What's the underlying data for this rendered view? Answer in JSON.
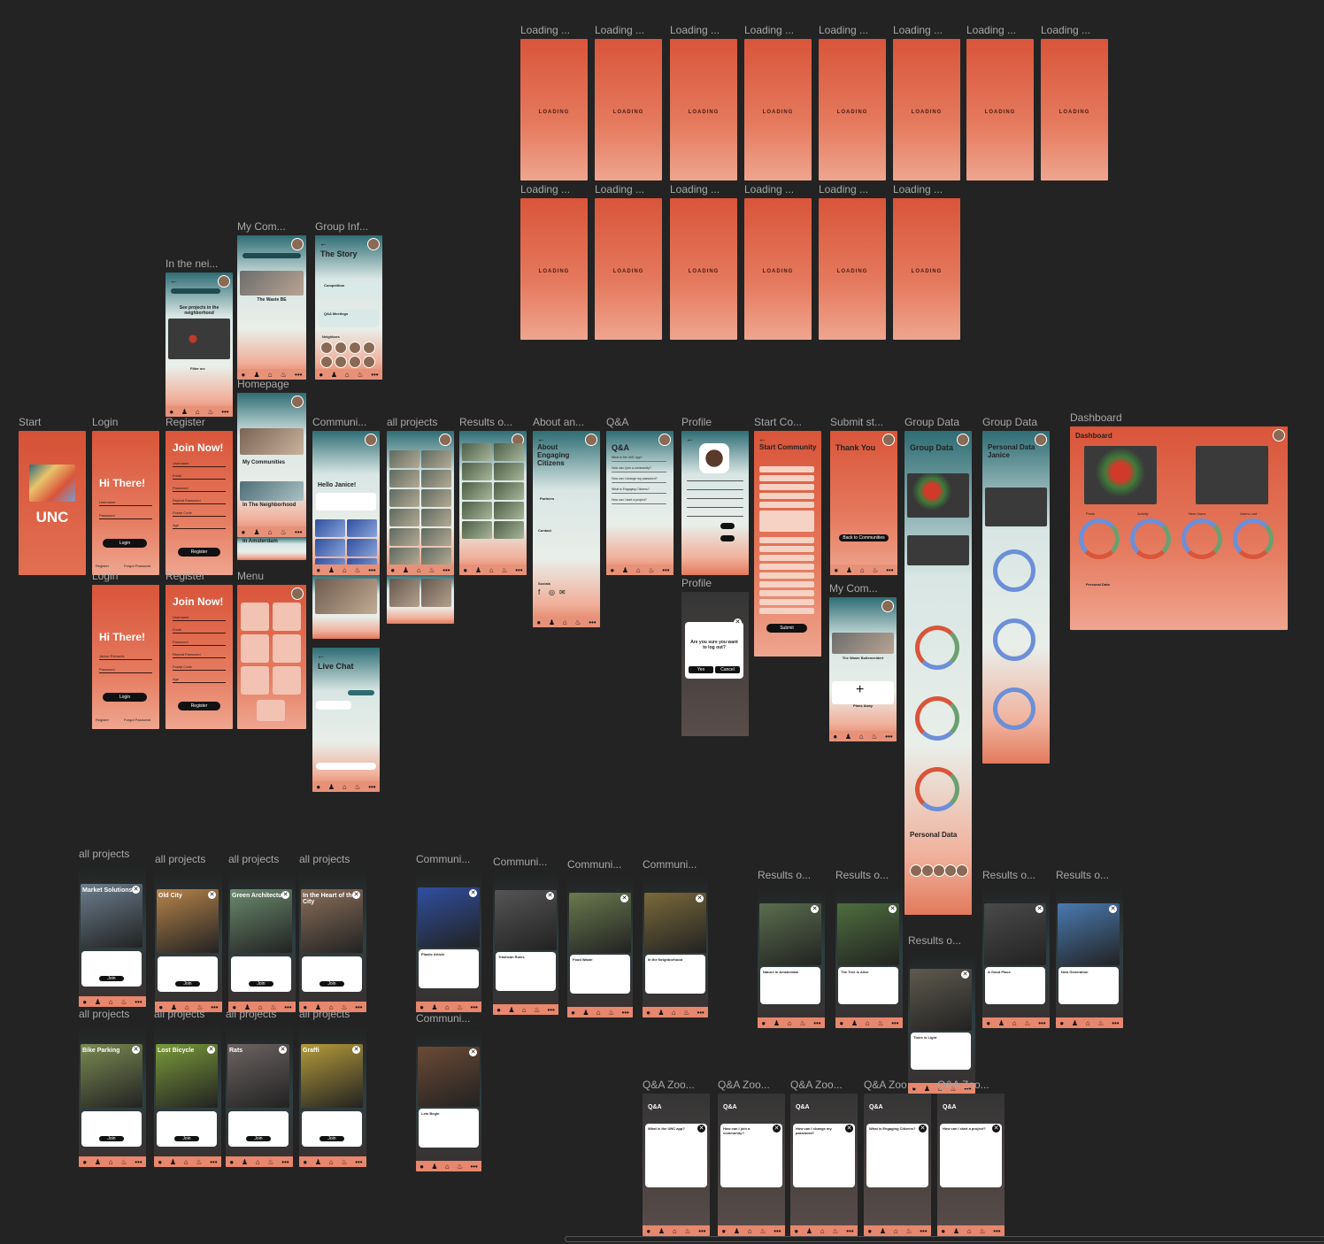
{
  "colors": {
    "canvas": "#232323",
    "brand": "#d9553a",
    "teal": "#2f6c72"
  },
  "labels": {
    "loading": "Loading ...",
    "start": "Start",
    "login": "Login",
    "register": "Register",
    "menu": "Menu",
    "in_neighborhood": "In the nei...",
    "my_communities": "My Com...",
    "group_info": "Group Inf...",
    "homepage": "Homepage",
    "communities": "Communi...",
    "all_projects": "all projects",
    "results": "Results o...",
    "about": "About an...",
    "qa": "Q&A",
    "profile": "Profile",
    "start_community": "Start Co...",
    "submit": "Submit st...",
    "group_data": "Group Data",
    "dashboard": "Dashboard",
    "qa_zoom": "Q&A Zoo..."
  },
  "loading_screen_text": "LOADING",
  "screens": {
    "start_logo": "UNC",
    "login_title": "Hi There!",
    "login_user": "Username",
    "login_pass": "Password",
    "login_btn": "Login",
    "login_link_register": "Register",
    "login_link_forgot": "Forgot Password",
    "login2_user": "Janice Richards",
    "register_title": "Join Now!",
    "register_btn": "Register",
    "register_fields": [
      "Username",
      "Email",
      "Password",
      "Repeat Password",
      "Postal Code",
      "Age"
    ],
    "group_info_title": "The Story",
    "group_info_section1": "Competition",
    "group_info_section2": "Q&A Meetings",
    "group_info_section3": "Neighbors",
    "neighborhood_title": "See projects in the neighborhood",
    "neighborhood_filter": "Filter on:",
    "my_comm_item": "The Waste BE",
    "homepage_tiles": [
      "My Communities",
      "In The Neighborhood",
      "In Amsterdam"
    ],
    "communities_greeting": "Hello Janice!",
    "live_chat": "Live Chat",
    "about_title": "About Engaging Citizens",
    "about_partners": "Partners",
    "about_contact": "Contact",
    "about_socials": "Socials",
    "qa_title": "Q&A",
    "qa_questions": [
      "What is the UNC app?",
      "How can I join a community?",
      "How can I change my password?",
      "What is Engaging Citizens?",
      "How can I start a project?"
    ],
    "start_comm_title": "Start Community",
    "submit_title": "Thank You",
    "submit_btn": "Back to Communities",
    "submit_btn2": "Submit",
    "group_data_title": "Group Data",
    "personal_data_title": "Personal Data Janice",
    "personal_data_short": "Personal Data",
    "logout_question": "Are you sure you want to log out?",
    "logout_yes": "Yes",
    "logout_cancel": "Cancel",
    "dashboard_title": "Dashboard",
    "dashboard_stats": [
      "Posts",
      "Activity",
      "New Users",
      "Users Lost"
    ],
    "dashboard_personal": "Personal Data",
    "my_comm_wide_title": "The Waste Buitenveldert",
    "plus_label": "Plans Away",
    "projects": [
      "Market Solutions",
      "Old City",
      "Green Architecture",
      "In the Heart of the City",
      "Bike Parking",
      "Lost Bicycle",
      "Rats",
      "Graffi"
    ],
    "project_btn": "Join",
    "comm_posts": [
      "Plastic Article",
      "Trashcan Rules",
      "Food Waste",
      "In the Neighborhood",
      "Lets Begin"
    ],
    "results_posts": [
      "Nature in Amsterdam",
      "The Tree is Alive",
      "There is Light",
      "A Good Place",
      "New Generation"
    ],
    "qa_zoom_questions": [
      "What is the UNC app?",
      "How can I join a community?",
      "How can I change my password?",
      "What is Engaging Citizens?",
      "How can I start a project?"
    ]
  }
}
